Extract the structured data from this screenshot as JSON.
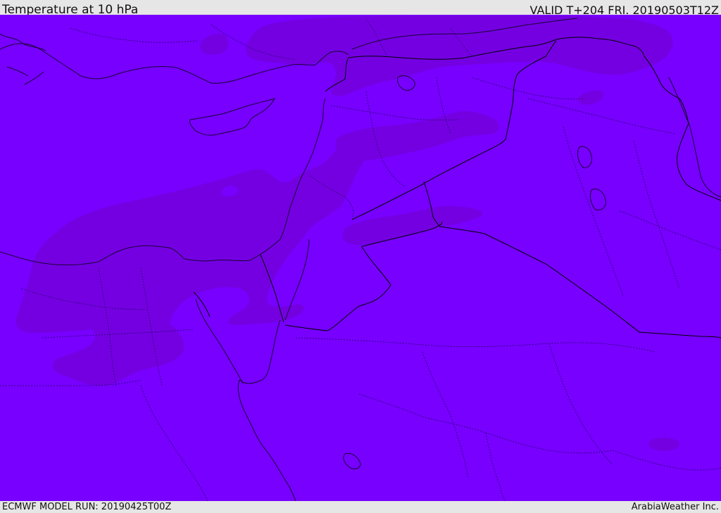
{
  "header": {
    "title": "Temperature at 10 hPa",
    "valid": "VALID T+204 FRI. 20190503T12Z"
  },
  "footer": {
    "model_run": "ECMWF MODEL RUN: 20190425T00Z",
    "brand": "ArabiaWeather Inc."
  },
  "map": {
    "colors": {
      "base_field": "#7700ff",
      "warm_field": "#7400e2",
      "coastline": "#1a0033",
      "border": "#000000"
    }
  }
}
